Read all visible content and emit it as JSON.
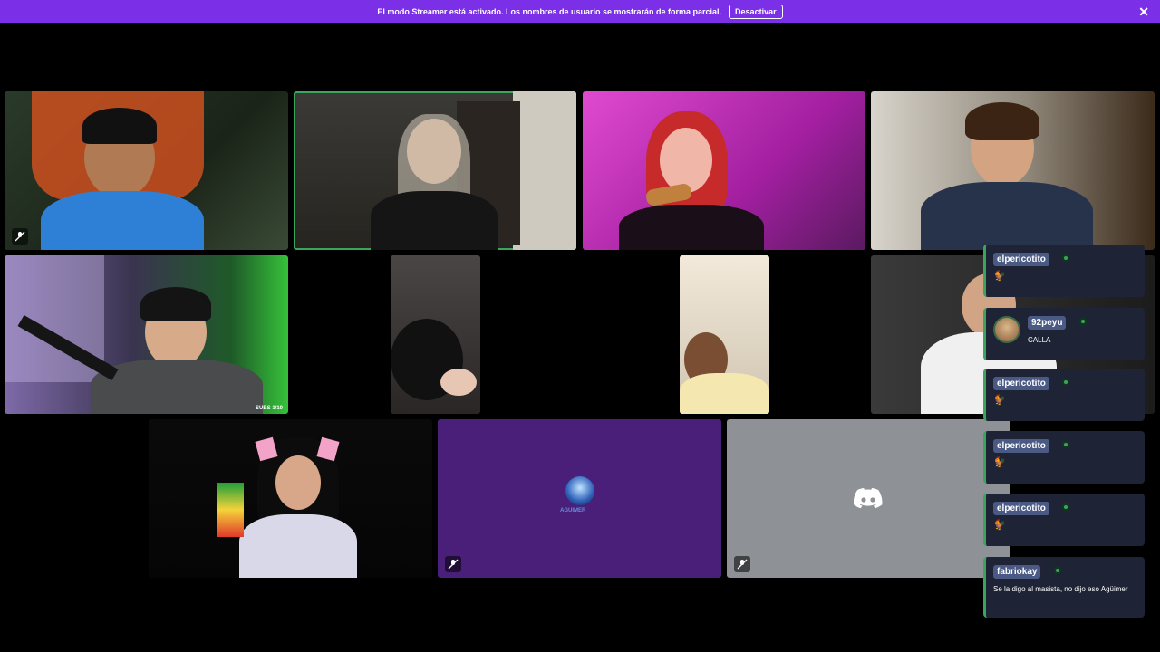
{
  "banner": {
    "message": "El modo Streamer está activado. Los nombres de usuario se mostrarán de forma parcial.",
    "button_label": "Desactivar",
    "close_icon": "✕"
  },
  "tiles": {
    "caption_subs": "SUBS 1/10",
    "server_logo_text": "AGUIMER"
  },
  "chat": [
    {
      "user": "elpericotito",
      "text": "",
      "emote": "🐓"
    },
    {
      "user": "92peyu",
      "text": "CALLA",
      "emote": "",
      "avatar": true
    },
    {
      "user": "elpericotito",
      "text": "",
      "emote": "🐓"
    },
    {
      "user": "elpericotito",
      "text": "",
      "emote": "🐓"
    },
    {
      "user": "elpericotito",
      "text": "",
      "emote": "🐓"
    },
    {
      "user": "fabriokay",
      "text": "Se la digo al masista, no dijo eso Agüimer",
      "emote": ""
    }
  ],
  "colors": {
    "banner": "#7b2fe6",
    "speaking": "#3ba55d",
    "chat_bg": "#1e2436",
    "discord_tile": "#8e9297",
    "server_tile": "#4a1f7a"
  },
  "icons": {
    "mute": "mic-muted-icon",
    "discord": "discord-logo-icon",
    "close": "close-icon",
    "status": "online-status-icon"
  }
}
